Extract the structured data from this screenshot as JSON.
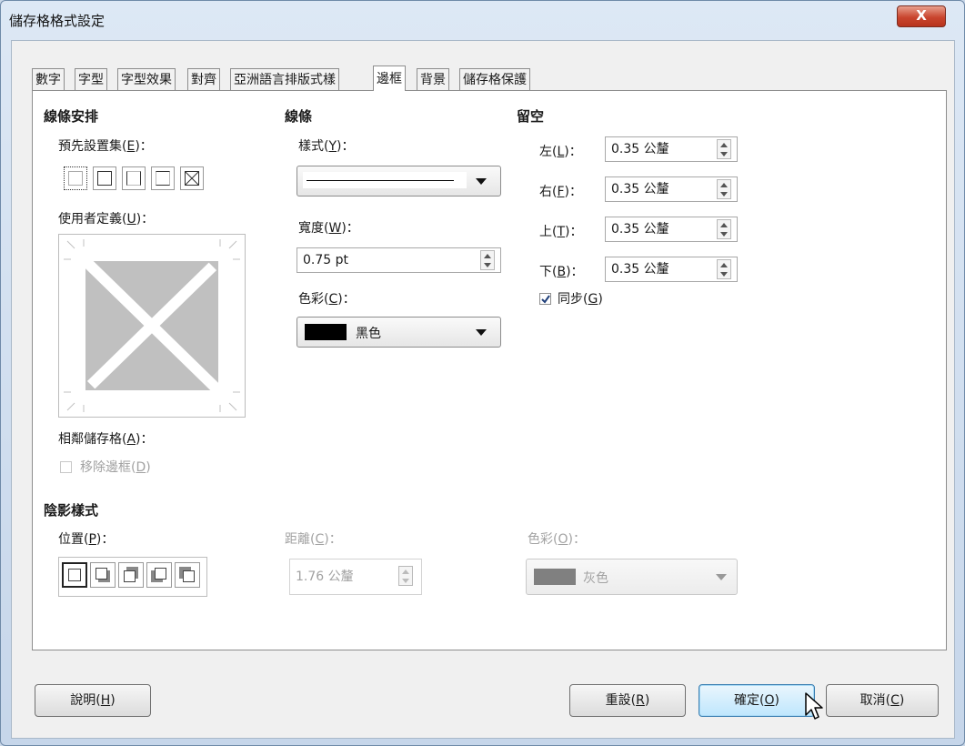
{
  "window": {
    "title": "儲存格格式設定",
    "close_label": "X"
  },
  "tabs": [
    {
      "label": "數字"
    },
    {
      "label": "字型"
    },
    {
      "label": "字型效果"
    },
    {
      "label": "對齊"
    },
    {
      "label": "亞洲語言排版式樣"
    },
    {
      "label": "邊框",
      "active": true
    },
    {
      "label": "背景"
    },
    {
      "label": "儲存格保護"
    }
  ],
  "line_arrangement": {
    "heading": "線條安排",
    "presets_label": "預先設置集(",
    "presets_key": "E",
    "presets_suffix": ")：",
    "user_defined_label": "使用者定義(",
    "user_defined_key": "U",
    "user_defined_suffix": ")：",
    "adjacent_label": "相鄰儲存格(",
    "adjacent_key": "A",
    "adjacent_suffix": ")：",
    "remove_border_label": "移除邊框(",
    "remove_border_key": "D",
    "remove_border_suffix": ")",
    "remove_border_checked": false
  },
  "line": {
    "heading": "線條",
    "style_label": "樣式(",
    "style_key": "Y",
    "style_suffix": ")：",
    "width_label": "寬度(",
    "width_key": "W",
    "width_suffix": ")：",
    "width_value": "0.75 pt",
    "color_label": "色彩(",
    "color_key": "C",
    "color_suffix": ")：",
    "color_value": "黑色",
    "color_swatch": "#000000"
  },
  "padding": {
    "heading": "留空",
    "left_label": "左(",
    "left_key": "L",
    "left_suffix": ")：",
    "left_value": "0.35 公釐",
    "right_label": "右(",
    "right_key": "F",
    "right_suffix": ")：",
    "right_value": "0.35 公釐",
    "top_label": "上(",
    "top_key": "T",
    "top_suffix": ")：",
    "top_value": "0.35 公釐",
    "bottom_label": "下(",
    "bottom_key": "B",
    "bottom_suffix": ")：",
    "bottom_value": "0.35 公釐",
    "sync_label": "同步(",
    "sync_key": "G",
    "sync_suffix": ")",
    "sync_checked": true
  },
  "shadow": {
    "heading": "陰影樣式",
    "position_label": "位置(",
    "position_key": "P",
    "position_suffix": ")：",
    "distance_label": "距離(",
    "distance_key": "C",
    "distance_suffix": ")：",
    "distance_value": "1.76 公釐",
    "color_label": "色彩(",
    "color_key": "O",
    "color_suffix": ")：",
    "color_value": "灰色",
    "color_swatch": "#808080"
  },
  "buttons": {
    "help_label": "說明(",
    "help_key": "H",
    "help_suffix": ")",
    "reset_label": "重設(",
    "reset_key": "R",
    "reset_suffix": ")",
    "ok_label": "確定(",
    "ok_key": "O",
    "ok_suffix": ")",
    "cancel_label": "取消(",
    "cancel_key": "C",
    "cancel_suffix": ")"
  }
}
